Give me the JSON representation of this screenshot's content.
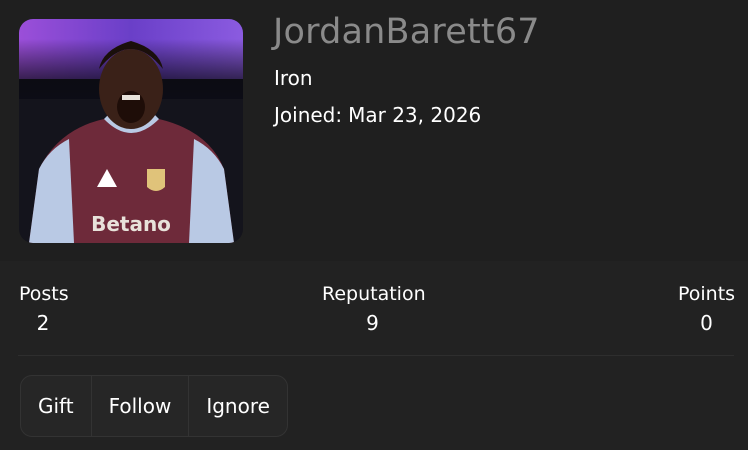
{
  "profile": {
    "username": "JordanBarett67",
    "rank": "Iron",
    "joined_label": "Joined:",
    "joined_date": "Mar 23, 2026",
    "avatar_icon": "player-photo-avatar"
  },
  "stats": {
    "posts": {
      "label": "Posts",
      "value": "2"
    },
    "reputation": {
      "label": "Reputation",
      "value": "9"
    },
    "points": {
      "label": "Points",
      "value": "0"
    }
  },
  "actions": {
    "gift": "Gift",
    "follow": "Follow",
    "ignore": "Ignore"
  },
  "colors": {
    "background": "#222222",
    "header_background": "#1f1f1f",
    "username": "#8a8a8a",
    "text": "#ffffff",
    "button_background": "#262626",
    "button_border": "#333333"
  }
}
